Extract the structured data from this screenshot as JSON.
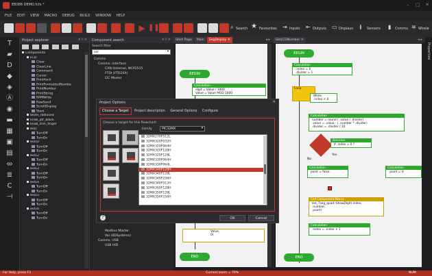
{
  "window": {
    "title": "EB086 DEMO.fcfx *"
  },
  "menu": [
    "FILE",
    "EDIT",
    "VIEW",
    "MACRO",
    "DEBUG",
    "BUILD",
    "WINDOW",
    "HELP"
  ],
  "toolbar": {
    "search": "Search",
    "favourites": "Favourites",
    "inputs": "Inputs",
    "outputs": "Outputs",
    "displays": "Displays",
    "sensors": "Sensors",
    "comms": "Comms",
    "wireless": "Wirele"
  },
  "project_explorer": {
    "title": "Project explorer",
    "pin": "▾ ☨ ✕",
    "items": [
      {
        "label": "Components",
        "level": 0
      },
      {
        "label": "LCD",
        "level": 1
      },
      {
        "label": "Clear",
        "level": 2
      },
      {
        "label": "ClearLine",
        "level": 2
      },
      {
        "label": "Command",
        "level": 2
      },
      {
        "label": "Cursor",
        "level": 2
      },
      {
        "label": "PrintAscii",
        "level": 2
      },
      {
        "label": "PrintFormattedNumbe",
        "level": 2
      },
      {
        "label": "PrintNumber",
        "level": 2
      },
      {
        "label": "PrintString",
        "level": 2
      },
      {
        "label": "RAMWrite",
        "level": 2
      },
      {
        "label": "RawSend",
        "level": 2
      },
      {
        "label": "ScrollDisplay",
        "level": 2
      },
      {
        "label": "Start",
        "level": 2
      },
      {
        "label": "bezel_radiused",
        "level": 1
      },
      {
        "label": "knob_ptr_black",
        "level": 1
      },
      {
        "label": "knob_trim_finger",
        "level": 1
      },
      {
        "label": "led1",
        "level": 1
      },
      {
        "label": "TurnOff",
        "level": 2
      },
      {
        "label": "TurnOn",
        "level": 2
      },
      {
        "label": "led10",
        "level": 1
      },
      {
        "label": "TurnOff",
        "level": 2
      },
      {
        "label": "TurnOn",
        "level": 2
      },
      {
        "label": "led12",
        "level": 1
      },
      {
        "label": "TurnOff",
        "level": 2
      },
      {
        "label": "TurnOn",
        "level": 2
      },
      {
        "label": "led13",
        "level": 1
      },
      {
        "label": "TurnOff",
        "level": 2
      },
      {
        "label": "TurnOn",
        "level": 2
      },
      {
        "label": "led14",
        "level": 1
      },
      {
        "label": "TurnOff",
        "level": 2
      },
      {
        "label": "TurnOn",
        "level": 2
      },
      {
        "label": "led15",
        "level": 1
      },
      {
        "label": "TurnOff",
        "level": 2
      },
      {
        "label": "TurnOn",
        "level": 2
      },
      {
        "label": "led16",
        "level": 1
      },
      {
        "label": "TurnOff",
        "level": 2
      },
      {
        "label": "TurnOn",
        "level": 2
      }
    ]
  },
  "component_search": {
    "title": "Component search",
    "pin": "▾ ☨ ✕",
    "filter_label": "Search filter",
    "filter_value": "ser",
    "items": [
      "Comms",
      "Comms: Interface",
      "CAN (Internal, MCP2515",
      "FTDI (FTD2XX)",
      "I2C Master"
    ],
    "bottom_items": [
      "Modbus Master",
      "Vai (4DSystems)",
      "Comms: USB",
      "USB HID"
    ]
  },
  "tabs1": {
    "items": [
      "Start Page",
      "Main",
      "SegDisplay"
    ],
    "active": "SegDisplay",
    "arrows": "◂ ▸"
  },
  "tabs2": {
    "items": [
      "SetLCDNumber"
    ],
    "arrows": "◂ ▸"
  },
  "flow_left": {
    "begin": "BEGIN",
    "calc_title": "Calculation",
    "calc_body": "digit = Value / 1000\nValue = Value MOD 1000",
    "partial": "Value,\n0)",
    "end": "END"
  },
  "flow_right": {
    "begin": "BEGIN",
    "calc1_title": "Calculation",
    "calc1_body": ".index = 0\n.divider = 1",
    "loop_title": "Loop",
    "loop_body": "While\n.index < 4",
    "calc2_title": "Calculation",
    "calc2_body": "number = round ( .value / .divider)\n.value = .value - ( .number * .divider)\n.divider = .divider / 10",
    "decision_title": "Decision",
    "decision_body": "If .index = 0 ?",
    "yes": "Yes",
    "no": "No",
    "calc3_title": "Calculation",
    "calc3_body": "point = false",
    "calc4_title": "Calculation",
    "calc4_body": ".point = tr",
    "macro_title": "Call Component Macro",
    "macro_body": "led_7seg_quad::ShowDigit(.index,\n.number,\n.point)",
    "calc5_title": "Calculation",
    "calc5_body": ".index = .index + 1",
    "end": "END"
  },
  "properties_label": "Properties",
  "dialog": {
    "title": "Project Options",
    "close": "✕",
    "tabs": [
      "Choose a Target",
      "Project description",
      "General Options",
      "Configure"
    ],
    "active_tab": "Choose a Target",
    "instruction": "Choose a target for this flowchart:",
    "family_label": "Family",
    "family_value": "PIC32MX",
    "targets": [
      "32MX270F512L",
      "32MX320F032H",
      "32MX320F064H",
      "32MX320F128H",
      "32MX320F128L",
      "32MX330F064H",
      "32MX330F064L",
      "32MX340F128H",
      "32MX340F128L",
      "32MX340F256H",
      "32MX340F512H",
      "32MX350F128H",
      "32MX350F128L",
      "32MX350F256H"
    ],
    "selected": "32MX340F128H",
    "ok": "OK",
    "cancel": "Cancel",
    "help": "?"
  },
  "statusbar": {
    "left": "For Help, press F1",
    "center": "Current zoom = 70%",
    "right": "NUM"
  }
}
